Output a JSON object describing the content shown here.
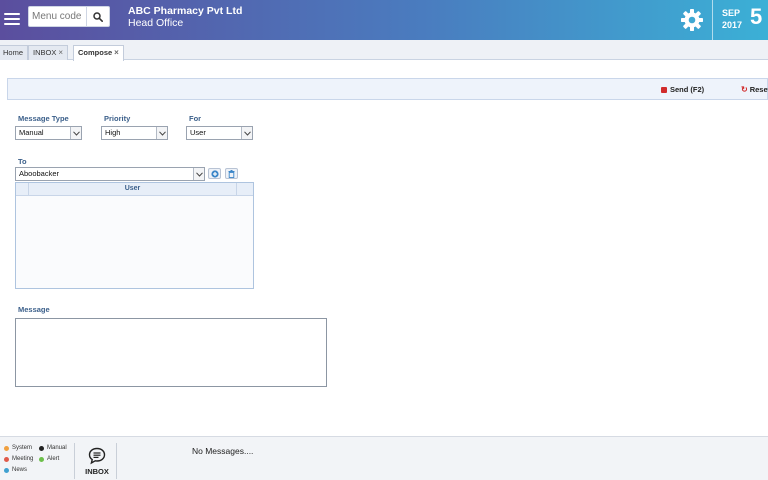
{
  "header": {
    "search_placeholder": "Menu code",
    "company_name": "ABC Pharmacy Pvt Ltd",
    "branch_name": "Head Office",
    "date": {
      "month": "SEP",
      "year": "2017",
      "day": "5"
    }
  },
  "tabs": [
    {
      "label": "Home",
      "closable": false,
      "active": false
    },
    {
      "label": "INBOX",
      "closable": true,
      "active": false
    },
    {
      "label": "Compose",
      "closable": true,
      "active": true
    }
  ],
  "toolbar": {
    "send_label": "Send (F2)",
    "reset_label": "Reset"
  },
  "form": {
    "message_type": {
      "label": "Message Type",
      "value": "Manual"
    },
    "priority": {
      "label": "Priority",
      "value": "High"
    },
    "for": {
      "label": "For",
      "value": "User"
    },
    "to": {
      "label": "To",
      "value": "Aboobacker"
    },
    "grid": {
      "column_header": "User",
      "rows": []
    },
    "message": {
      "label": "Message",
      "value": ""
    }
  },
  "footer": {
    "legend": [
      {
        "label": "System",
        "color": "#f0a040"
      },
      {
        "label": "Manual",
        "color": "#222222"
      },
      {
        "label": "Meeting",
        "color": "#e05a4a"
      },
      {
        "label": "Alert",
        "color": "#6cbf4a"
      },
      {
        "label": "News",
        "color": "#3fa0d0"
      }
    ],
    "inbox_label": "INBOX",
    "status_text": "No Messages...."
  },
  "icons": {
    "menu": "hamburger-icon",
    "search": "search-icon",
    "settings": "gear-icon",
    "add": "add-icon",
    "delete": "trash-icon",
    "inbox": "chat-icon"
  }
}
